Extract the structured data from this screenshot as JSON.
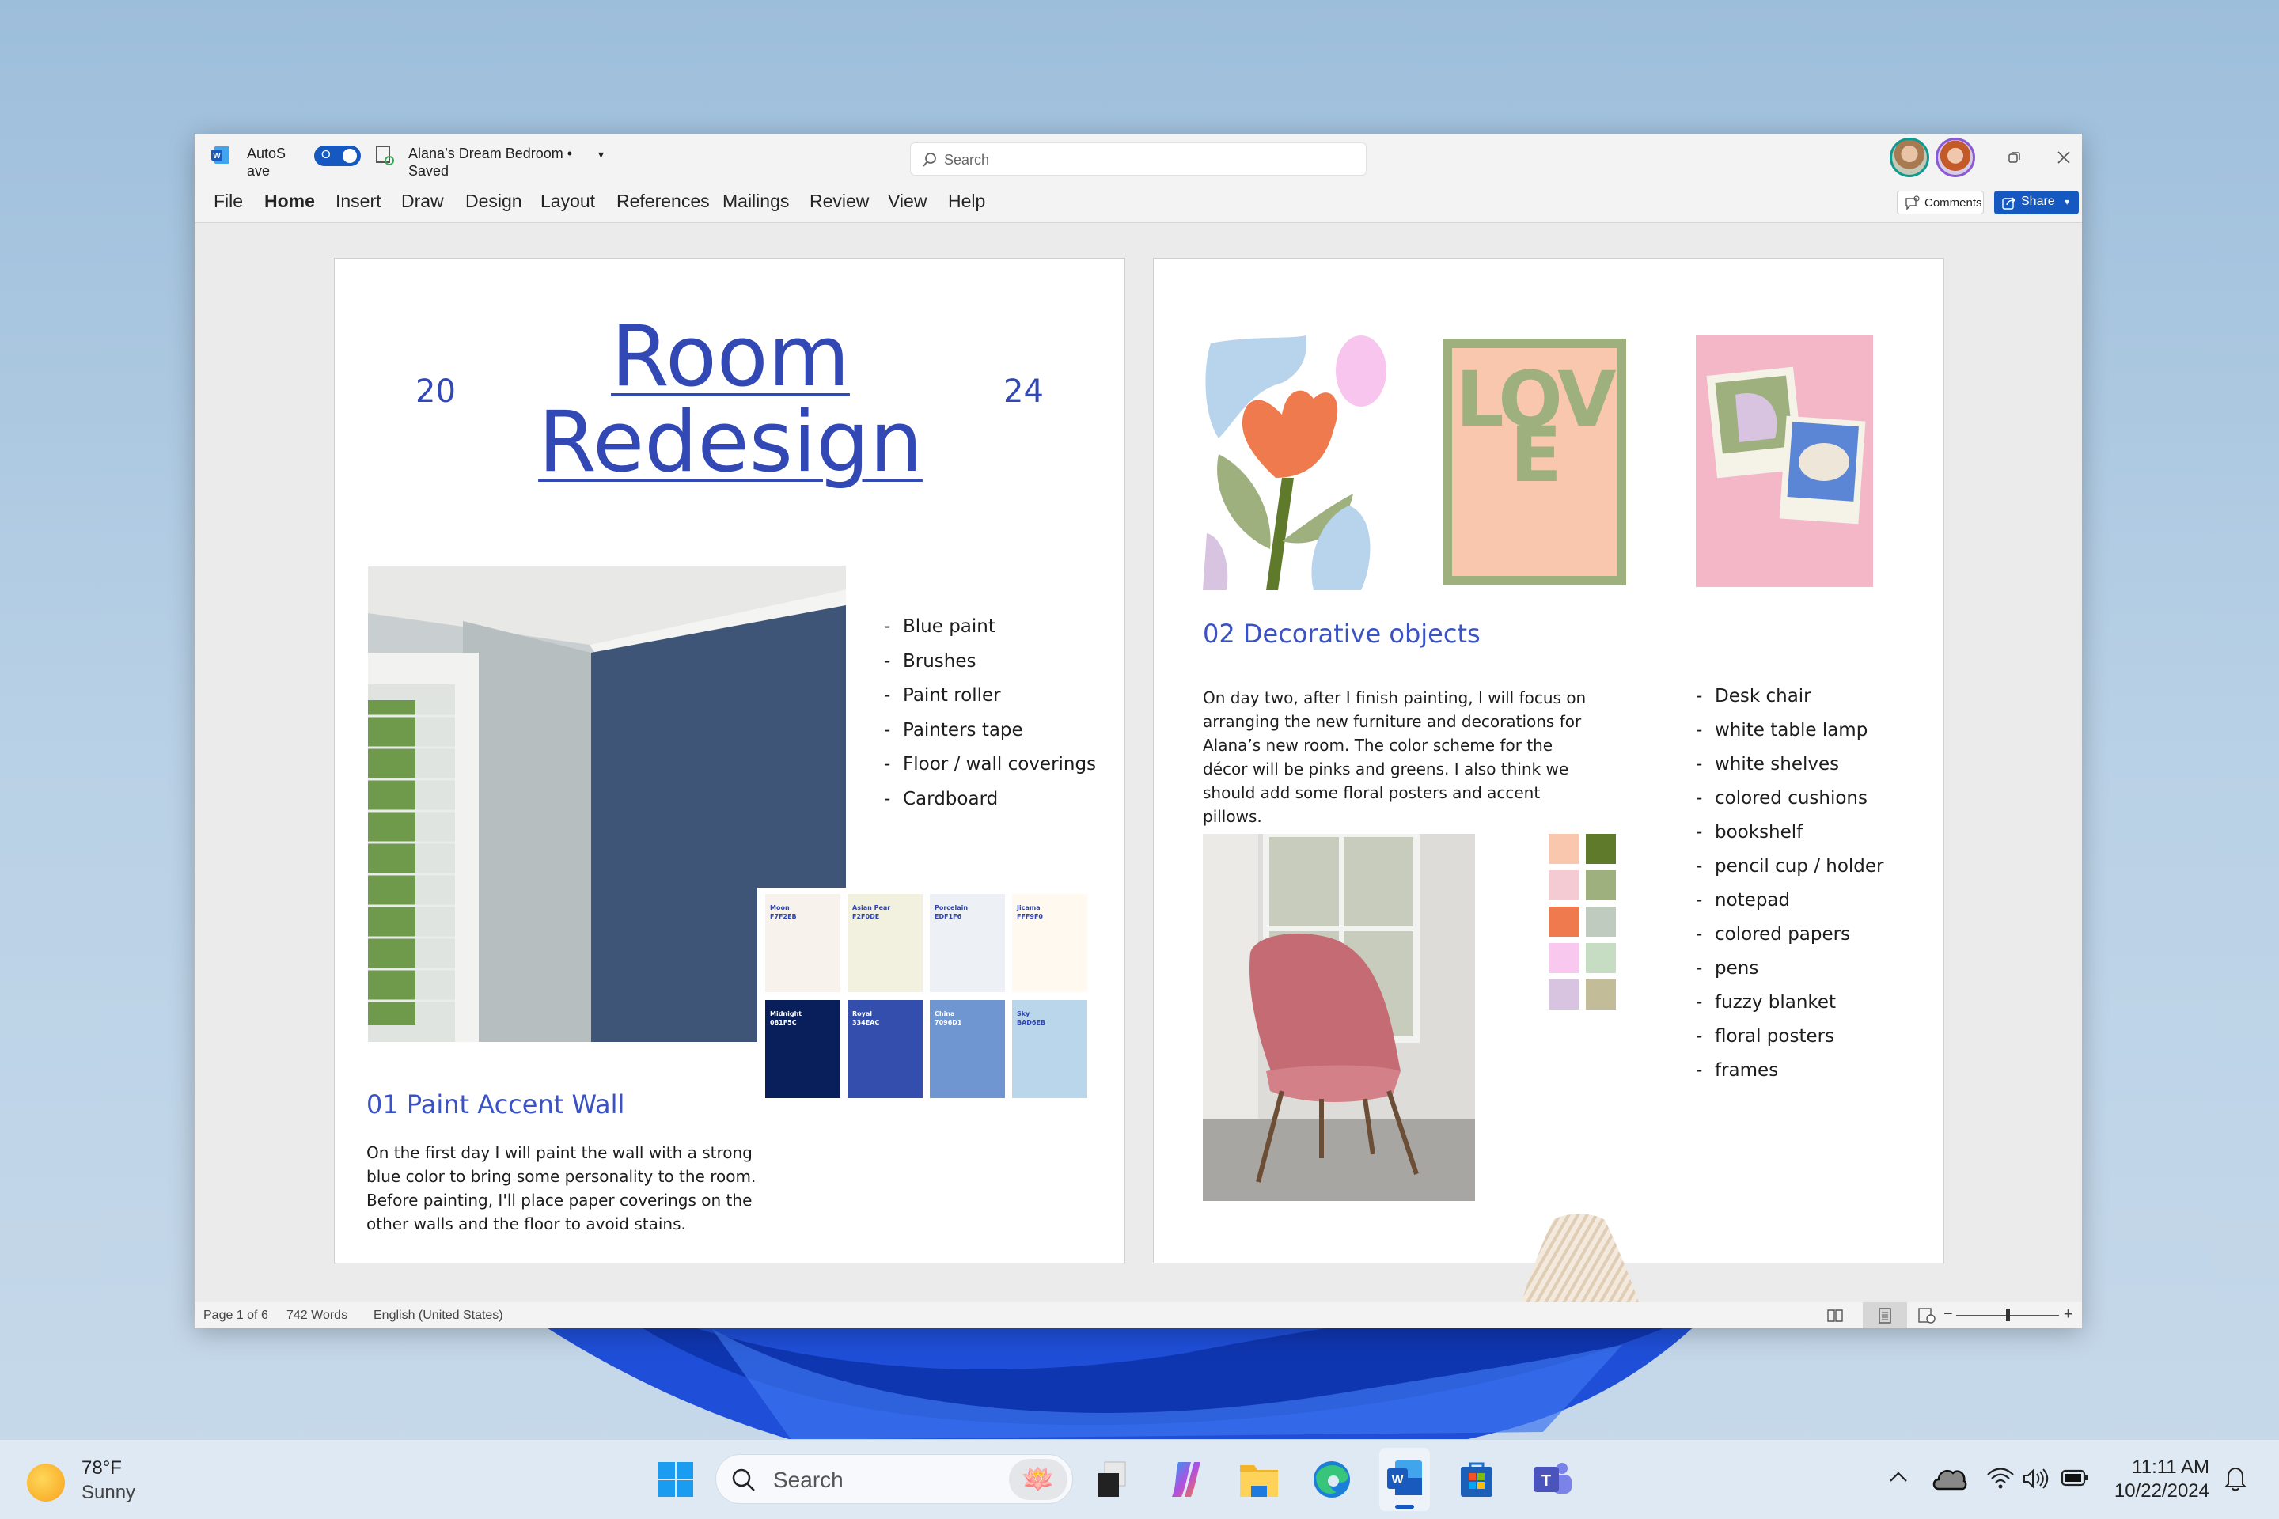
{
  "titlebar": {
    "autosave_label_1": "AutoS",
    "autosave_label_2": "ave",
    "autosave_toggle": "O",
    "doc_title": "Alana’s Dream Bedroom •",
    "doc_status": "Saved",
    "search_placeholder": "Search",
    "comments_label": "Comments",
    "share_label": "Share"
  },
  "ribbon": {
    "tabs": [
      "File",
      "Home",
      "Insert",
      "Draw",
      "Design",
      "Layout",
      "References",
      "Mailings",
      "Review",
      "View",
      "Help"
    ],
    "active_tab": "Home"
  },
  "page1": {
    "year_left": "20",
    "year_right": "24",
    "title_line1": "Room",
    "title_line2": "Redesign",
    "supplies": [
      "Blue paint",
      "Brushes",
      "Paint roller",
      "Painters tape",
      "Floor / wall coverings",
      "Cardboard"
    ],
    "swatches": [
      {
        "name": "Moon",
        "hex": "F7F2EB",
        "color": "#F7F2EB",
        "text": "#2f45b0"
      },
      {
        "name": "Asian Pear",
        "hex": "F2F0DE",
        "color": "#F2F0DE",
        "text": "#2f45b0"
      },
      {
        "name": "Porcelain",
        "hex": "EDF1F6",
        "color": "#EDF1F6",
        "text": "#2f45b0"
      },
      {
        "name": "Jicama",
        "hex": "FFF9F0",
        "color": "#FFF9F0",
        "text": "#2f45b0"
      },
      {
        "name": "Midnight",
        "hex": "081F5C",
        "color": "#081F5C",
        "text": "#ffffff"
      },
      {
        "name": "Royal",
        "hex": "334EAC",
        "color": "#334EAC",
        "text": "#ffffff"
      },
      {
        "name": "China",
        "hex": "7096D1",
        "color": "#7096D1",
        "text": "#ffffff"
      },
      {
        "name": "Sky",
        "hex": "BAD6EB",
        "color": "#BAD6EB",
        "text": "#2f45b0"
      }
    ],
    "heading": "01 Paint Accent Wall",
    "body": "On the first day I will paint the wall with a strong blue color to bring some personality to the room. Before painting, I'll place paper coverings on the other walls and the floor to avoid stains."
  },
  "page2": {
    "poster_text": "LOVE",
    "heading": "02 Decorative objects",
    "body": "On day two, after I finish painting, I will focus on arranging the new furniture and decorations for Alana’s new room. The color scheme for the décor will be pinks and greens. I also think we should add some floral posters and accent pillows.",
    "items": [
      "Desk chair",
      "white table lamp",
      "white shelves",
      "colored cushions",
      "bookshelf",
      "pencil cup / holder",
      "notepad",
      "colored papers",
      "pens",
      "fuzzy blanket",
      "floral posters",
      "frames"
    ],
    "palette": [
      "#f9c6ae",
      "#5f7a2a",
      "#f5cbd3",
      "#9fb07f",
      "#ef7a4d",
      "#c0cbc0",
      "#f8c8ee",
      "#c6dcc3",
      "#d8c3e0",
      "#c2bc98"
    ]
  },
  "statusbar": {
    "page": "Page 1 of 6",
    "words": "742 Words",
    "language": "English (United States)"
  },
  "taskbar": {
    "temperature": "78°F",
    "weather": "Sunny",
    "search_placeholder": "Search",
    "time": "11:11 AM",
    "date": "10/22/2024"
  },
  "colors": {
    "accent": "#3148b5",
    "share_button": "#1558c0",
    "word_blue": "#185abd"
  }
}
